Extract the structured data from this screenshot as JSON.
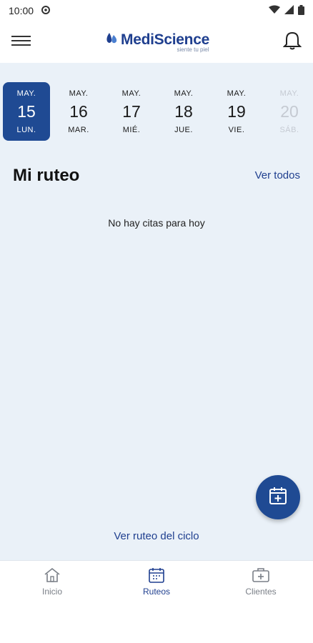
{
  "status_bar": {
    "time": "10:00"
  },
  "header": {
    "brand": "MediScience",
    "tagline": "siente tu piel"
  },
  "dates": [
    {
      "month": "MAY.",
      "day": "15",
      "weekday": "LUN.",
      "state": "selected"
    },
    {
      "month": "MAY.",
      "day": "16",
      "weekday": "MAR.",
      "state": "normal"
    },
    {
      "month": "MAY.",
      "day": "17",
      "weekday": "MIÉ.",
      "state": "normal"
    },
    {
      "month": "MAY.",
      "day": "18",
      "weekday": "JUE.",
      "state": "normal"
    },
    {
      "month": "MAY.",
      "day": "19",
      "weekday": "VIE.",
      "state": "normal"
    },
    {
      "month": "MAY.",
      "day": "20",
      "weekday": "SÁB.",
      "state": "disabled"
    }
  ],
  "main": {
    "title": "Mi ruteo",
    "see_all": "Ver todos",
    "empty_message": "No hay citas para hoy",
    "cycle_link": "Ver ruteo del ciclo"
  },
  "bottom_nav": [
    {
      "label": "Inicio",
      "icon": "home-icon",
      "active": false
    },
    {
      "label": "Ruteos",
      "icon": "calendar-icon",
      "active": true
    },
    {
      "label": "Clientes",
      "icon": "medical-case-icon",
      "active": false
    }
  ],
  "colors": {
    "primary": "#1f4a93",
    "background": "#eaf1f8",
    "disabled": "#c5cad2"
  }
}
